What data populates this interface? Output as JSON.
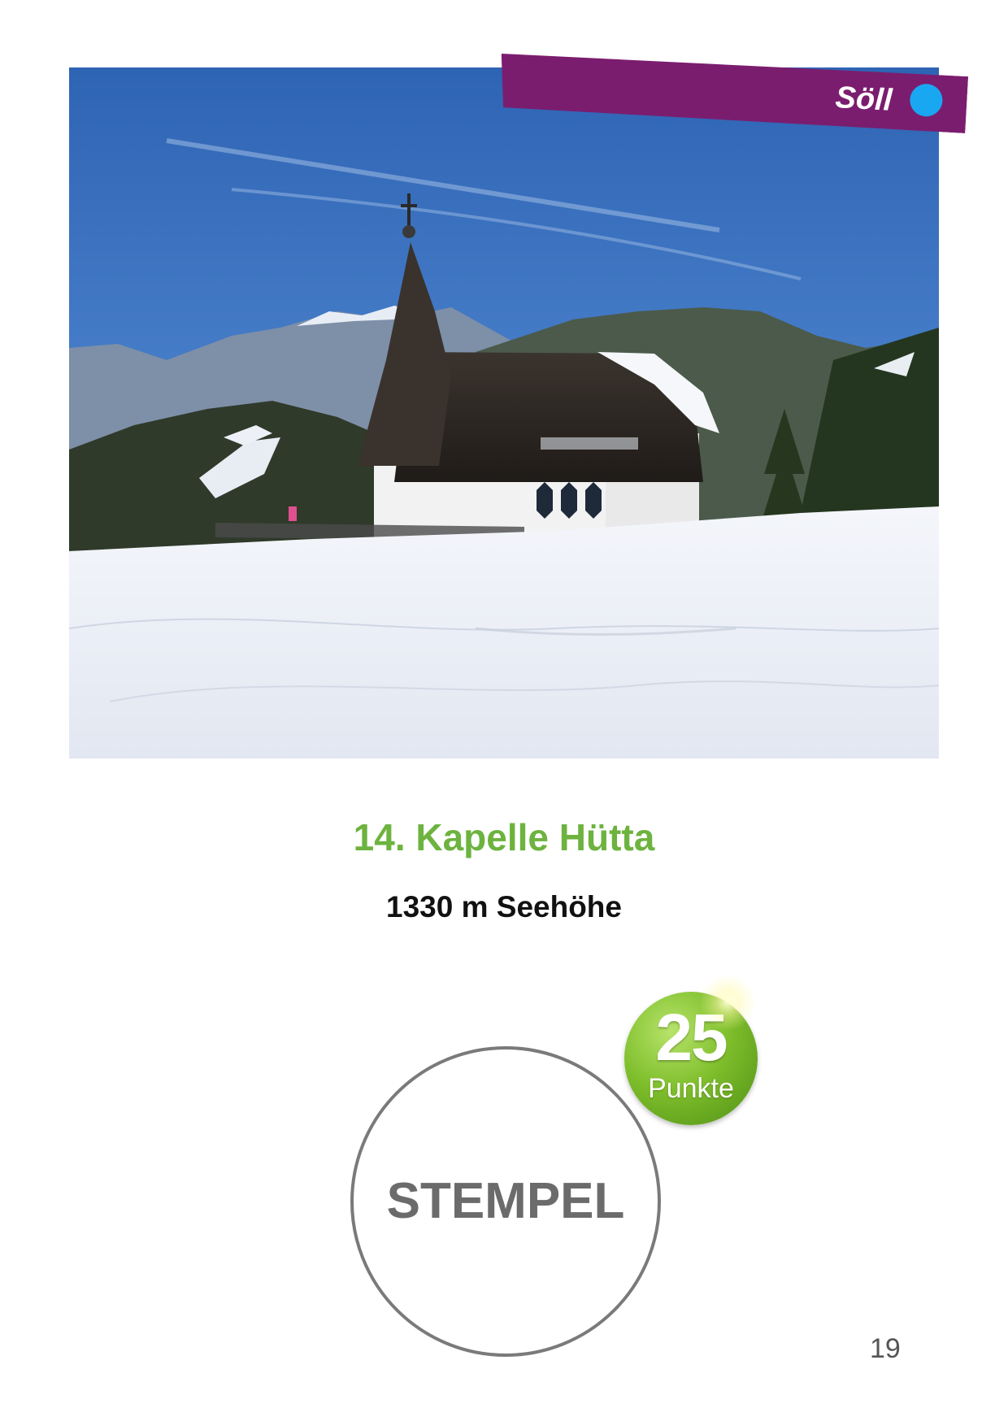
{
  "header": {
    "region_label": "Söll",
    "ribbon_color": "#7b1d6f",
    "dot_color": "#1aa7f2"
  },
  "photo": {
    "subject": "Chapel with pointed spire on a snowy ski slope, mountains and blue sky behind"
  },
  "station": {
    "title": "14. Kapelle Hütta",
    "title_color": "#6db33f",
    "altitude": "1330 m Seehöhe"
  },
  "stamp": {
    "label": "STEMPEL"
  },
  "points_badge": {
    "value": "25",
    "unit": "Punkte"
  },
  "footer": {
    "page_number": "19"
  }
}
